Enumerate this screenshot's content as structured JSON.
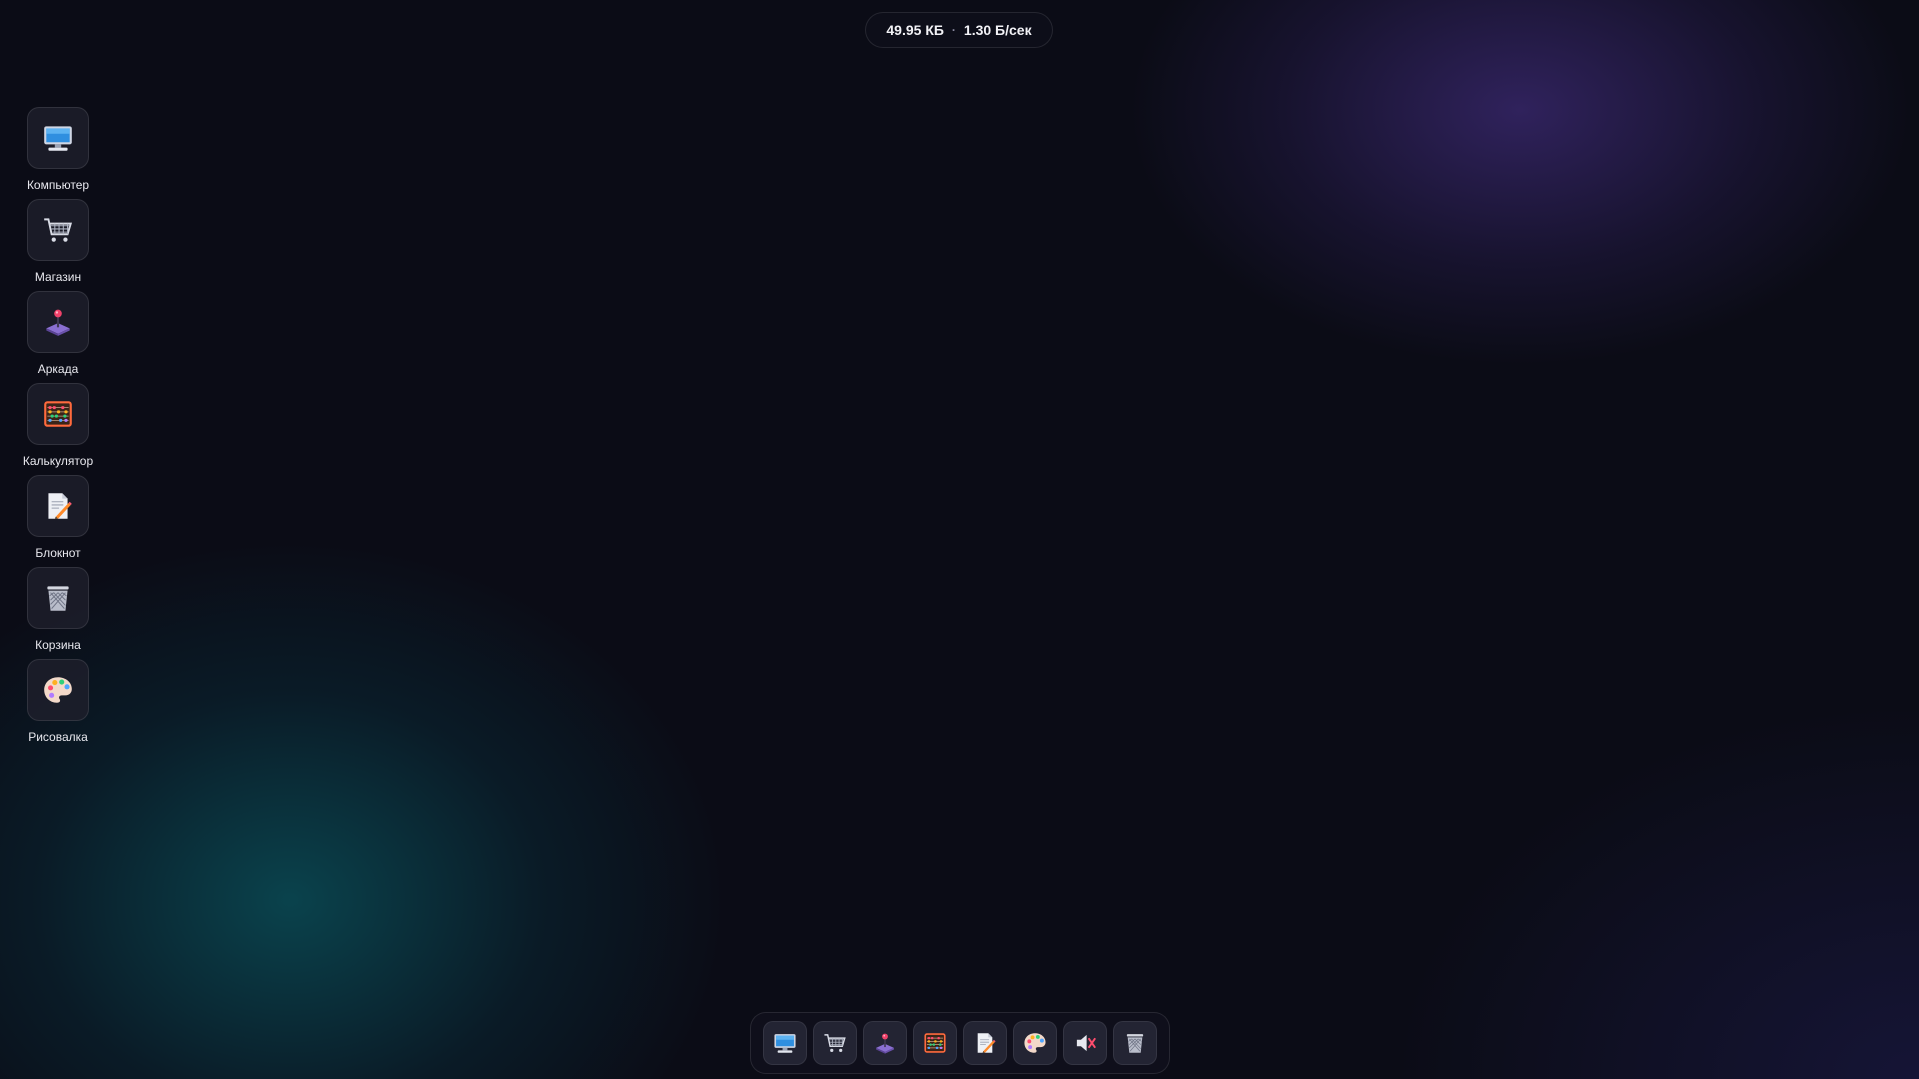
{
  "status_bar": {
    "size": "49.95 КБ",
    "separator": "·",
    "speed": "1.30 Б/сек"
  },
  "desktop": {
    "items": [
      {
        "label": "Компьютер",
        "icon": "computer-icon"
      },
      {
        "label": "Магазин",
        "icon": "shopping-cart-icon"
      },
      {
        "label": "Аркада",
        "icon": "joystick-icon"
      },
      {
        "label": "Калькулятор",
        "icon": "abacus-icon"
      },
      {
        "label": "Блокнот",
        "icon": "notepad-icon"
      },
      {
        "label": "Корзина",
        "icon": "trash-bin-icon"
      },
      {
        "label": "Рисовалка",
        "icon": "palette-icon"
      }
    ]
  },
  "dock": {
    "items": [
      {
        "icon": "computer-icon"
      },
      {
        "icon": "shopping-cart-icon"
      },
      {
        "icon": "joystick-icon"
      },
      {
        "icon": "abacus-icon"
      },
      {
        "icon": "notepad-icon"
      },
      {
        "icon": "palette-icon"
      },
      {
        "icon": "muted-speaker-icon"
      },
      {
        "icon": "trash-bin-icon"
      }
    ]
  },
  "colors": {
    "background": "#0b0c16",
    "glow_purple": "#4e3496",
    "glow_teal": "#0a555f"
  }
}
